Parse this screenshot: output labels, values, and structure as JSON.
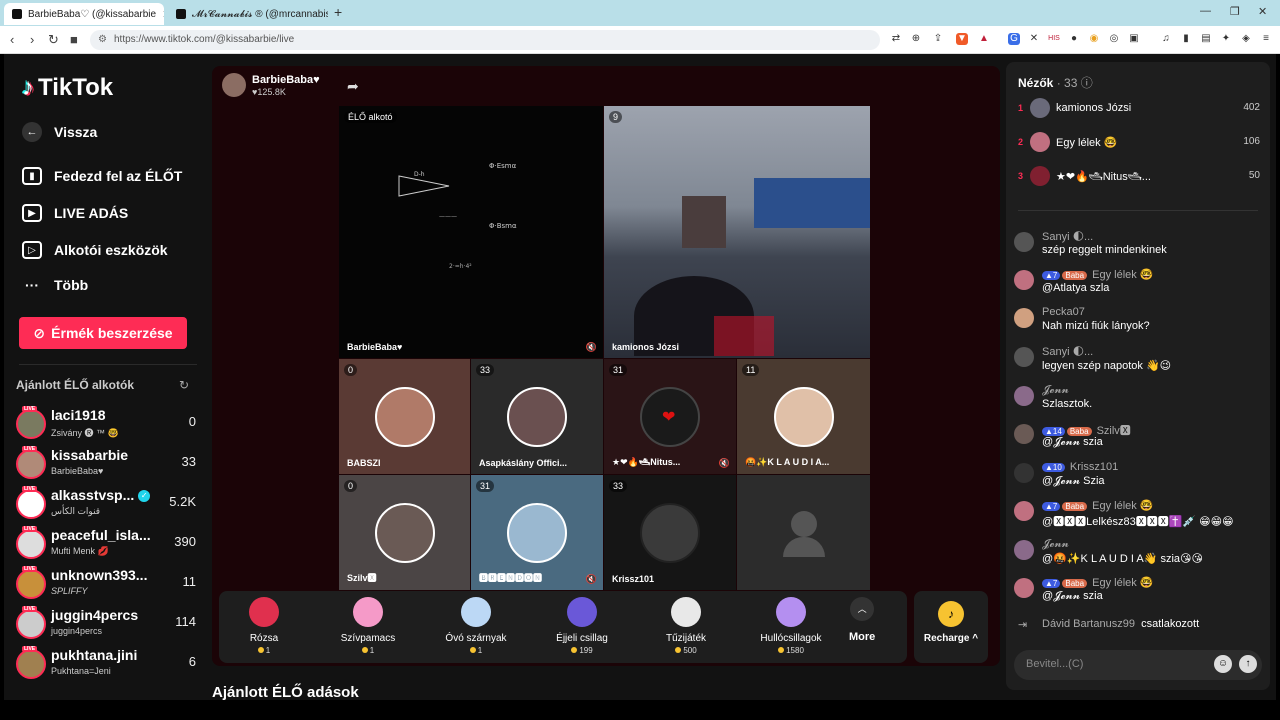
{
  "browser": {
    "tabs": [
      {
        "title": "BarbieBaba♡ (@kissabarbie",
        "active": true
      },
      {
        "title": "𝓜𝓻𝓒𝓪𝓷𝓷𝓪𝓫𝓲𝓼 ® (@mrcannabis",
        "active": false
      }
    ],
    "url": "https://www.tiktok.com/@kissabarbie/live"
  },
  "sidebar": {
    "logo": "TikTok",
    "nav": [
      {
        "label": "Vissza",
        "icon": "back-arrow-icon"
      },
      {
        "label": "Fedezd fel az ÉLŐT",
        "icon": "live-tv-icon"
      },
      {
        "label": "LIVE ADÁS",
        "icon": "video-camera-icon"
      },
      {
        "label": "Alkotói eszközök",
        "icon": "creator-tools-icon"
      },
      {
        "label": "Több",
        "icon": "more-dots-icon"
      }
    ],
    "coins_button": "Érmék beszerzése",
    "recommended_title": "Ajánlott ÉLŐ alkotók",
    "creators": [
      {
        "name": "laci1918",
        "sub": "Zsivány 🅡 ™ 🤓",
        "count": "0"
      },
      {
        "name": "kissabarbie",
        "sub": "BarbieBaba♥",
        "count": "33"
      },
      {
        "name": "alkasstvsp...",
        "sub": "قنوات الكأس",
        "count": "5.2K"
      },
      {
        "name": "peaceful_isla...",
        "sub": "Mufti Menk 💋",
        "count": "390"
      },
      {
        "name": "unknown393...",
        "sub": "SPLIFFY",
        "count": "11"
      },
      {
        "name": "juggin4percs",
        "sub": "juggin4percs",
        "count": "114"
      },
      {
        "name": "pukhtana.jini",
        "sub": "Pukhtana=Jeni",
        "count": "6"
      }
    ]
  },
  "stage": {
    "host_name": "BarbieBaba♥",
    "host_likes": "♥125.8K",
    "tiles": [
      {
        "badge": "ÉLŐ alkotó",
        "name": "BarbieBaba♥"
      },
      {
        "badge": "9",
        "name": "kamionos Józsi"
      },
      {
        "badge": "0",
        "name": "BABSZI"
      },
      {
        "badge": "33",
        "name": "Asapkáslány Offici..."
      },
      {
        "badge": "31",
        "name": "★❤🔥🛥Nitus..."
      },
      {
        "badge": "11",
        "name": "🤬✨K L A U D I A..."
      },
      {
        "badge": "0",
        "name": "Szilv🆇"
      },
      {
        "badge": "31",
        "name": "🅱🆁🅴🅽🅳🅾🅽"
      },
      {
        "badge": "33",
        "name": "Krissz101"
      }
    ],
    "gifts": [
      {
        "name": "Rózsa",
        "price": "1",
        "color": "#e0304e"
      },
      {
        "name": "Szívpamacs",
        "price": "1",
        "color": "#f59ac8"
      },
      {
        "name": "Óvó szárnyak",
        "price": "1",
        "color": "#bcd8f5"
      },
      {
        "name": "Éjjeli csillag",
        "price": "199",
        "color": "#6a58d8"
      },
      {
        "name": "Tűzijáték",
        "price": "500",
        "color": "#e8e8e8"
      },
      {
        "name": "Hullócsillagok",
        "price": "1580",
        "color": "#b48ff0"
      }
    ],
    "more_label": "More",
    "recharge_label": "Recharge",
    "suggested_title": "Ajánlott ÉLŐ adások"
  },
  "chat": {
    "viewers_title": "Nézők",
    "viewers_count": "· 33",
    "top_viewers": [
      {
        "rank": "1",
        "name": "kamionos Józsi",
        "score": "402"
      },
      {
        "rank": "2",
        "name": "Egy lélek 🤓",
        "score": "106"
      },
      {
        "rank": "3",
        "name": "★❤🔥🛥Nitus🛥...",
        "score": "50"
      }
    ],
    "messages": [
      {
        "user": "Sanyi 🌓...",
        "text": "szép reggelt mindenkinek",
        "badges": ""
      },
      {
        "user": "Egy lélek 🤓",
        "text": "@Atlatya szla",
        "badges": "7 Baba"
      },
      {
        "user": "Pecka07",
        "text": "Nah mizú fiúk lányok?",
        "badges": ""
      },
      {
        "user": "Sanyi 🌓...",
        "text": "legyen szép napotok 👋😉",
        "badges": ""
      },
      {
        "user": "𝓙𝓮𝓷𝓷",
        "text": "Szlasztok.",
        "badges": ""
      },
      {
        "user": "Szilv🆇",
        "text": "@𝓙𝓮𝓷𝓷 szia",
        "badges": "14 Baba"
      },
      {
        "user": "Krissz101",
        "text": "@𝓙𝓮𝓷𝓷 Szia",
        "badges": "10"
      },
      {
        "user": "Egy lélek 🤓",
        "text": "@🆇🆇🆇Lelkész83🆇🆇🆇✝️💉 😁😁😁",
        "badges": "7 Baba"
      },
      {
        "user": "𝓙𝓮𝓷𝓷",
        "text": "@🤬✨K L A U D I A👋 szia😘😘",
        "badges": ""
      },
      {
        "user": "Egy lélek 🤓",
        "text": "@𝓙𝓮𝓷𝓷 szia",
        "badges": "7 Baba"
      },
      {
        "user": "Dávid Bartanusz99",
        "text": "csatlakozott",
        "badges": ""
      }
    ],
    "input_placeholder": "Bevitel...(C)"
  }
}
